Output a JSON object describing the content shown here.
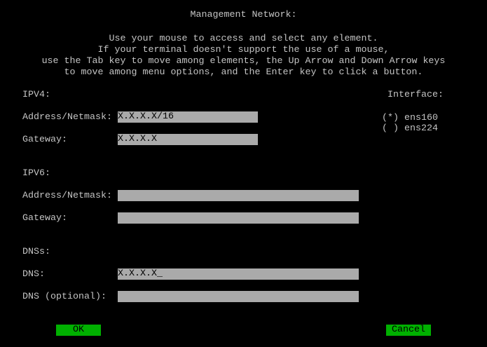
{
  "title": "Management Network:",
  "instructions": [
    "Use your mouse to access and select any element.",
    "If your terminal doesn't support the use of a mouse,",
    "use the Tab key to move among elements, the Up Arrow and Down Arrow keys",
    "to move among menu options, and the Enter key to click a button."
  ],
  "ipv4": {
    "heading": "IPV4:",
    "address_label": "Address/Netmask:",
    "address_value": "X.X.X.X/16",
    "gateway_label": "Gateway:",
    "gateway_value": "X.X.X.X"
  },
  "ipv6": {
    "heading": "IPV6:",
    "address_label": "Address/Netmask:",
    "address_value": "",
    "gateway_label": "Gateway:",
    "gateway_value": ""
  },
  "dns": {
    "heading": "DNSs:",
    "dns_label": "DNS:",
    "dns_value": "X.X.X.X",
    "dns_cursor": "_",
    "optional_label": "DNS (optional):",
    "optional_value": ""
  },
  "interface": {
    "heading": "Interface:",
    "options": [
      {
        "marker": "(*)",
        "name": "ens160",
        "selected": true
      },
      {
        "marker": "( )",
        "name": "ens224",
        "selected": false
      }
    ]
  },
  "buttons": {
    "ok": "OK",
    "cancel": "Cancel"
  },
  "colors": {
    "text": "#c4c4c4",
    "field": "#aaaaaa",
    "button": "#00b000"
  }
}
